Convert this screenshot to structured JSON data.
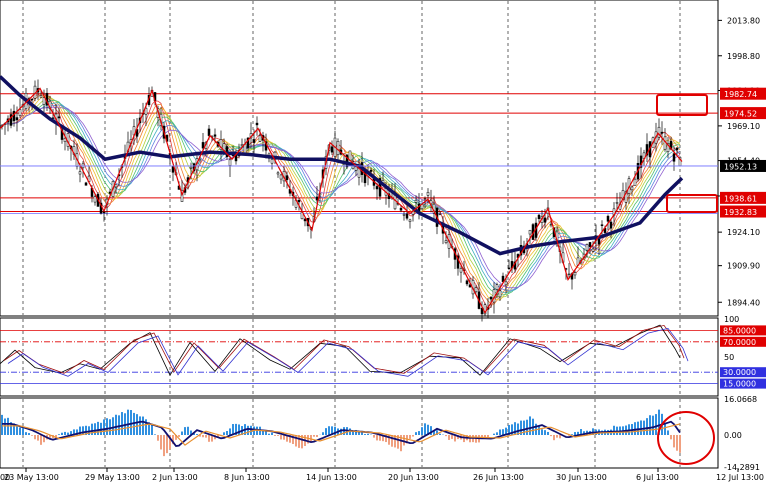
{
  "chart_data": [
    {
      "type": "line",
      "panel": "price",
      "ylim": [
        1889.0,
        2022.0
      ],
      "yticks": [
        "2013.80",
        "1998.80",
        "1984.10",
        "1969.10",
        "1954.40",
        "1939.40",
        "1924.10",
        "1909.90",
        "1894.40"
      ],
      "current_price": "1952.13",
      "hlines": [
        {
          "value": 1982.74,
          "label": "1982.74"
        },
        {
          "value": 1974.52,
          "label": "1974.52"
        },
        {
          "value": 1938.61,
          "label": "1938.61"
        },
        {
          "value": 1932.83,
          "label": "1932.83"
        }
      ],
      "zigzag": [
        [
          0,
          1968
        ],
        [
          40,
          1985
        ],
        [
          104,
          1933
        ],
        [
          152,
          1984
        ],
        [
          182,
          1940
        ],
        [
          210,
          1965
        ],
        [
          232,
          1955
        ],
        [
          258,
          1968
        ],
        [
          312,
          1925
        ],
        [
          330,
          1962
        ],
        [
          410,
          1932
        ],
        [
          428,
          1938
        ],
        [
          485,
          1890
        ],
        [
          548,
          1934
        ],
        [
          568,
          1904
        ],
        [
          615,
          1932
        ],
        [
          658,
          1966
        ],
        [
          682,
          1954
        ]
      ],
      "slow_ma": [
        [
          0,
          1990
        ],
        [
          20,
          1982
        ],
        [
          50,
          1972
        ],
        [
          80,
          1964
        ],
        [
          105,
          1955
        ],
        [
          140,
          1958
        ],
        [
          170,
          1956
        ],
        [
          210,
          1958
        ],
        [
          250,
          1957
        ],
        [
          290,
          1955
        ],
        [
          330,
          1955
        ],
        [
          360,
          1952
        ],
        [
          390,
          1942
        ],
        [
          420,
          1932
        ],
        [
          460,
          1924
        ],
        [
          500,
          1915
        ],
        [
          530,
          1918
        ],
        [
          560,
          1920
        ],
        [
          600,
          1922
        ],
        [
          640,
          1928
        ],
        [
          665,
          1940
        ],
        [
          682,
          1947
        ]
      ]
    },
    {
      "type": "line",
      "panel": "oscillator",
      "ylim": [
        0,
        100
      ],
      "yticks": [
        "100",
        "85.0000",
        "70.0000",
        "50",
        "30.0000",
        "15.0000"
      ],
      "levels": [
        85,
        70,
        30,
        15
      ]
    },
    {
      "type": "bar",
      "panel": "histogram",
      "ylim": [
        -14.2891,
        16.0668
      ],
      "yticks": [
        "16.0668",
        "0.00",
        "-14.2891"
      ]
    }
  ],
  "xticks": [
    "00",
    "23 May 13:00",
    "29 May 13:00",
    "2 Jun 13:00",
    "8 Jun 13:00",
    "14 Jun 13:00",
    "20 Jun 13:00",
    "26 Jun 13:00",
    "30 Jun 13:00",
    "6 Jul 13:00",
    "12 Jul 13:00"
  ],
  "colors": {
    "grid": "#000000",
    "level_line": "#e00000",
    "blue_line": "#4040ff",
    "slow_ma": "#101060",
    "zigzag": "#e00000",
    "candle": "#000000",
    "hist_pos": "#3090e0",
    "hist_neg": "#f0a080"
  }
}
